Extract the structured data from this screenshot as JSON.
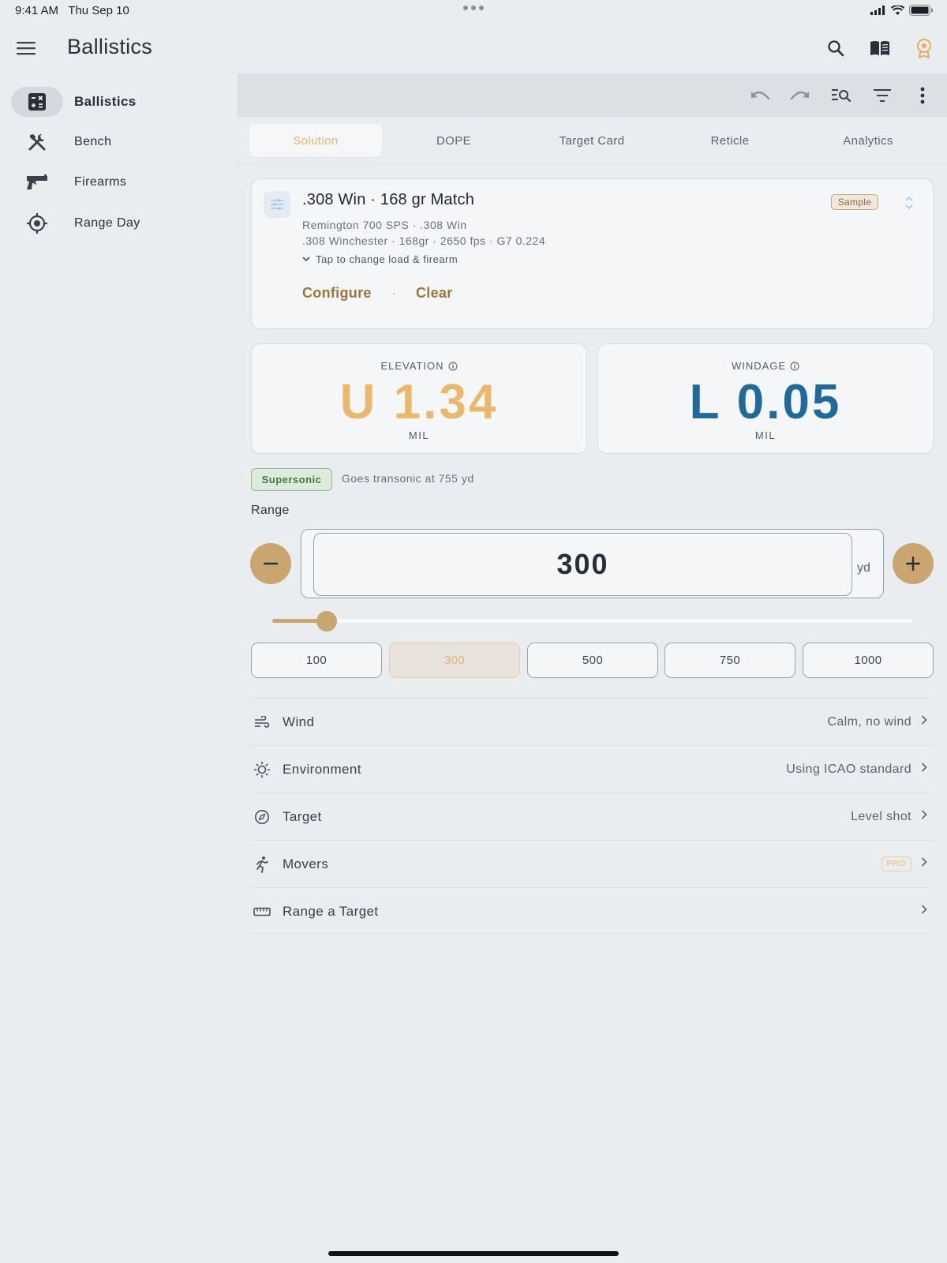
{
  "status_bar": {
    "time": "9:41 AM",
    "date": "Thu Sep 10"
  },
  "app": {
    "title": "Ballistics"
  },
  "header_icons": [
    "search-icon",
    "book-icon",
    "award-icon"
  ],
  "sidebar": {
    "items": [
      {
        "label": "Ballistics",
        "icon": "calculator-icon",
        "active": true
      },
      {
        "label": "Bench",
        "icon": "tools-icon",
        "active": false
      },
      {
        "label": "Firearms",
        "icon": "pistol-icon",
        "active": false
      },
      {
        "label": "Range Day",
        "icon": "crosshair-icon",
        "active": false
      }
    ]
  },
  "toolbar": {
    "icons": [
      "undo-icon",
      "redo-icon",
      "search-list-icon",
      "filter-icon",
      "more-vert-icon"
    ]
  },
  "tabs": [
    {
      "label": "Solution",
      "active": true
    },
    {
      "label": "DOPE",
      "active": false
    },
    {
      "label": "Target Card",
      "active": false
    },
    {
      "label": "Reticle",
      "active": false
    },
    {
      "label": "Analytics",
      "active": false
    }
  ],
  "load": {
    "title": ".308 Win · 168 gr Match",
    "firearm": "Remington 700 SPS · .308 Win",
    "details": ".308 Winchester · 168gr · 2650 fps · G7 0.224",
    "hint": "Tap to change load & firearm",
    "badge": "Sample",
    "configure_label": "Configure",
    "separator": "·",
    "clear_label": "Clear"
  },
  "elevation": {
    "label": "ELEVATION",
    "value": "U 1.34",
    "unit": "MIL",
    "color": "#e9b86c"
  },
  "windage": {
    "label": "WINDAGE",
    "value": "L 0.05",
    "unit": "MIL",
    "color": "#1f6a9a"
  },
  "speed": {
    "badge": "Supersonic",
    "note": "Goes transonic at 755 yd"
  },
  "range": {
    "label": "Range",
    "value": "300",
    "unit": "yd",
    "slider_fraction": 0.085,
    "presets": [
      {
        "label": "100",
        "active": false
      },
      {
        "label": "300",
        "active": true
      },
      {
        "label": "500",
        "active": false
      },
      {
        "label": "750",
        "active": false
      },
      {
        "label": "1000",
        "active": false
      }
    ]
  },
  "rows": [
    {
      "label": "Wind",
      "value": "Calm, no wind",
      "icon": "wind-icon"
    },
    {
      "label": "Environment",
      "value": "Using ICAO standard",
      "icon": "sun-icon"
    },
    {
      "label": "Target",
      "value": "Level shot",
      "icon": "compass-icon"
    },
    {
      "label": "Movers",
      "badge": "PRO",
      "icon": "runner-icon"
    },
    {
      "label": "Range a Target",
      "value": "",
      "icon": "ruler-icon"
    }
  ],
  "colors": {
    "accent": "#c9a56f",
    "accent_text": "#9a7438",
    "tab_active": "#e9b56a"
  }
}
